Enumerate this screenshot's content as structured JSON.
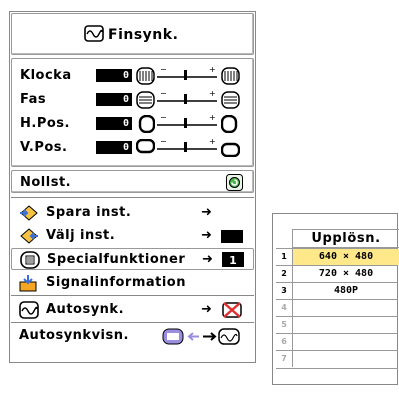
{
  "menu": {
    "title": "Finsynk.",
    "title_icon": "finsync-icon",
    "adjustments": [
      {
        "label": "Klocka",
        "value": "0",
        "icon": "clock-pattern-icon",
        "level": 0.5
      },
      {
        "label": "Fas",
        "value": "0",
        "icon": "phase-pattern-icon",
        "level": 0.5
      },
      {
        "label": "H.Pos.",
        "value": "0",
        "icon": "hpos-icon",
        "level": 0.5
      },
      {
        "label": "V.Pos.",
        "value": "0",
        "icon": "vpos-icon",
        "level": 0.5
      }
    ],
    "slider_minus": "−",
    "slider_plus": "+",
    "reset_label": "Nollst.",
    "items": [
      {
        "label": "Spara inst.",
        "icon": "save-setting-icon",
        "arrow": "➜"
      },
      {
        "label": "Välj inst.",
        "icon": "select-setting-icon",
        "arrow": "➜"
      },
      {
        "label": "Specialfunktioner",
        "icon": "special-mode-icon",
        "arrow": "➜"
      },
      {
        "label": "Signalinformation",
        "icon": "signal-info-icon",
        "arrow": ""
      },
      {
        "label": "Autosynk.",
        "icon": "autosync-icon",
        "arrow": "➜"
      },
      {
        "label": "Autosynkvisn.",
        "icon": "autosync-display-icon",
        "arrow": ""
      }
    ],
    "selected_index": 2
  },
  "resolution_table": {
    "header": "Upplösn.",
    "rows": [
      {
        "num": "1",
        "value": "640 × 480",
        "selected": true
      },
      {
        "num": "2",
        "value": "720 × 480",
        "selected": false
      },
      {
        "num": "3",
        "value": "480P",
        "selected": false
      },
      {
        "num": "4",
        "value": "",
        "selected": false
      },
      {
        "num": "5",
        "value": "",
        "selected": false
      },
      {
        "num": "6",
        "value": "",
        "selected": false
      },
      {
        "num": "7",
        "value": "",
        "selected": false
      }
    ]
  },
  "colors": {
    "highlight": "#ffe88a",
    "border": "#888888",
    "value_box": "#000000"
  }
}
